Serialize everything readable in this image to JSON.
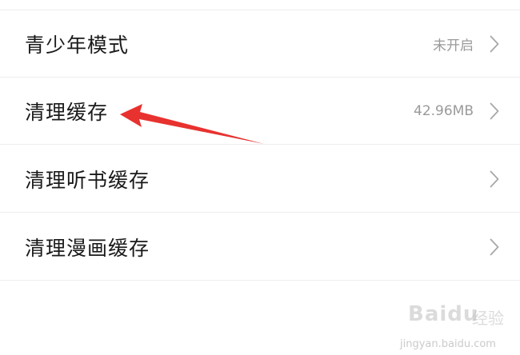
{
  "settings": {
    "items": [
      {
        "label": "青少年模式",
        "value": "未开启"
      },
      {
        "label": "清理缓存",
        "value": "42.96MB"
      },
      {
        "label": "清理听书缓存",
        "value": ""
      },
      {
        "label": "清理漫画缓存",
        "value": ""
      }
    ]
  },
  "annotation": {
    "arrow_color": "#e8322f"
  },
  "watermark": {
    "logo": "Baidu",
    "text": "经验",
    "url": "jingyan.baidu.com"
  },
  "icons": {
    "row_chevron": "chevron-right-icon",
    "annotation_arrow": "red-arrow-icon"
  }
}
